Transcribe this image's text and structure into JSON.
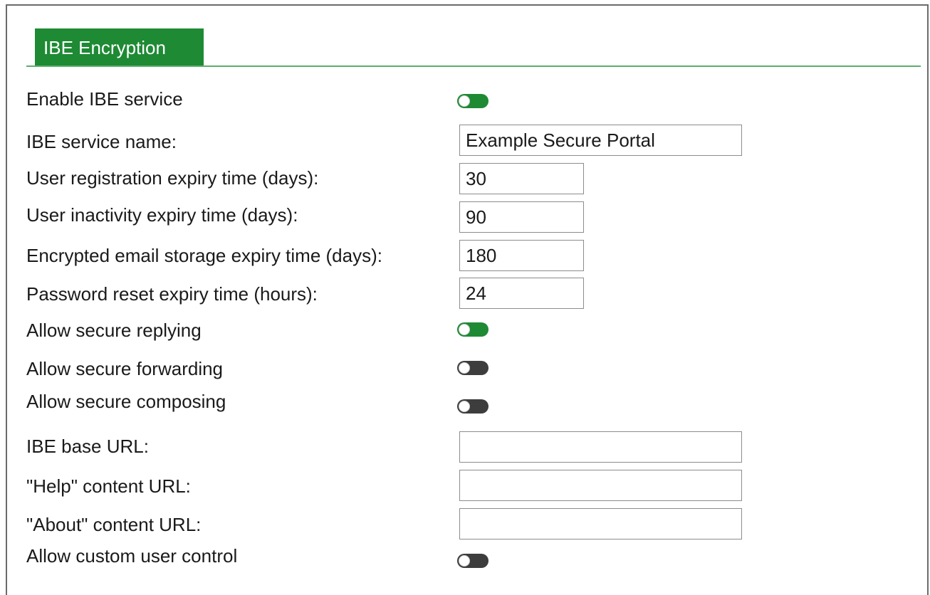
{
  "tab": {
    "label": "IBE Encryption"
  },
  "settings": {
    "enable_ibe": {
      "label": "Enable IBE service",
      "state": "on"
    },
    "service_name": {
      "label": "IBE service name:",
      "value": "Example Secure Portal"
    },
    "registration_expiry": {
      "label": "User registration expiry time (days):",
      "value": "30"
    },
    "inactivity_expiry": {
      "label": "User inactivity expiry time (days):",
      "value": "90"
    },
    "storage_expiry": {
      "label": "Encrypted email storage expiry time (days):",
      "value": "180"
    },
    "password_reset_expiry": {
      "label": "Password reset expiry time (hours):",
      "value": "24"
    },
    "secure_replying": {
      "label": "Allow secure replying",
      "state": "on"
    },
    "secure_forwarding": {
      "label": "Allow secure forwarding",
      "state": "off"
    },
    "secure_composing": {
      "label": "Allow secure composing",
      "state": "off"
    },
    "base_url": {
      "label": "IBE base URL:",
      "value": ""
    },
    "help_url": {
      "label": "\"Help\" content URL:",
      "value": ""
    },
    "about_url": {
      "label": "\"About\" content URL:",
      "value": ""
    },
    "custom_user_control": {
      "label": "Allow custom user control",
      "state": "off"
    }
  },
  "colors": {
    "accent_green": "#1e8a34",
    "toggle_off": "#3d3d3d",
    "tab_rule": "#5dae6e"
  }
}
